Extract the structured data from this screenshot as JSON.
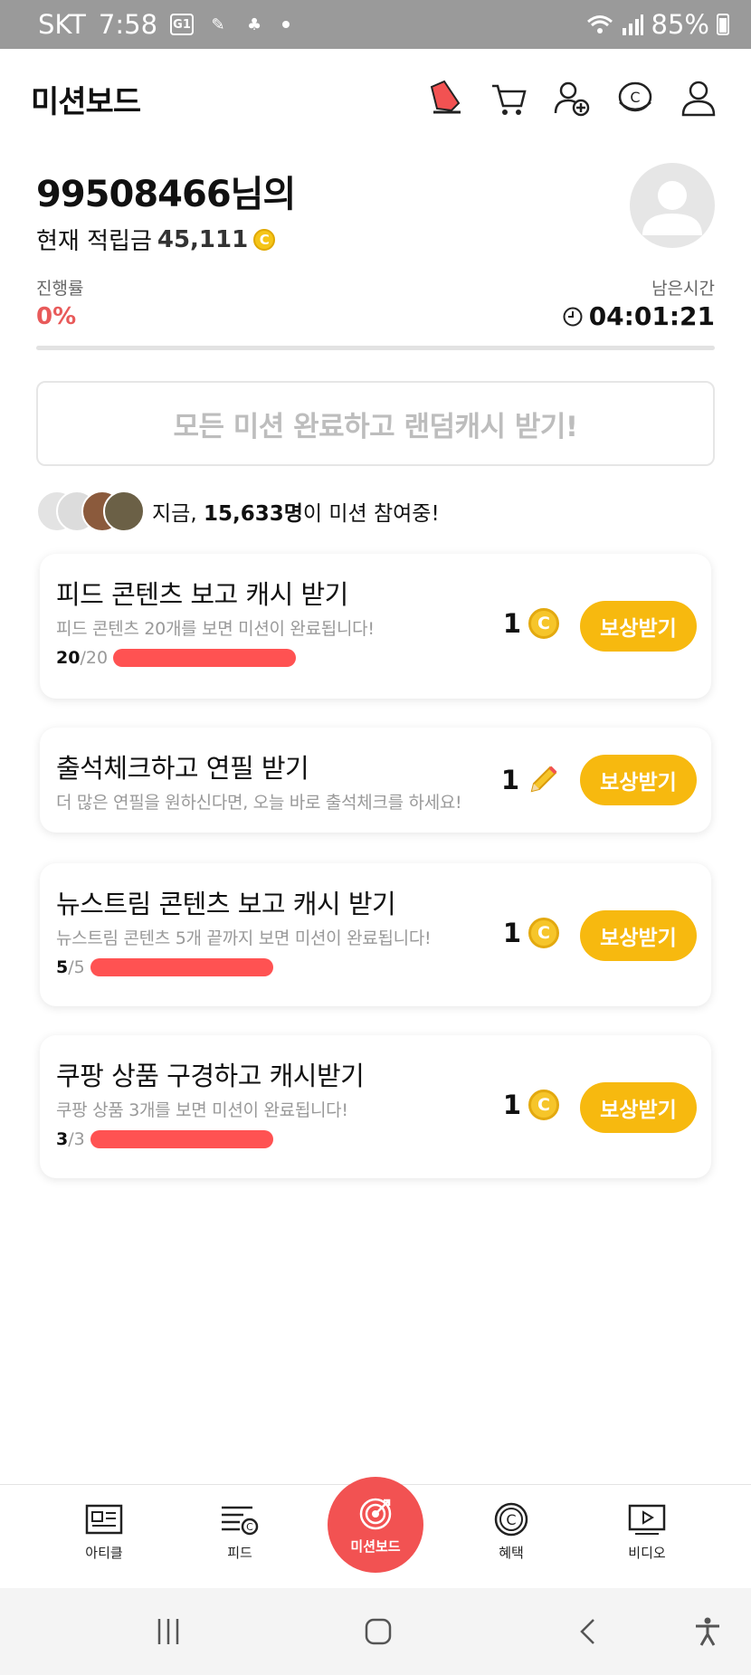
{
  "status_bar": {
    "carrier": "SKT",
    "time": "7:58",
    "battery": "85%"
  },
  "header": {
    "title": "미션보드"
  },
  "profile": {
    "name": "99508466님의",
    "balance_label": "현재 적립금",
    "balance": "45,111",
    "coin_symbol": "C"
  },
  "progress": {
    "label": "진행률",
    "value": "0%",
    "remaining_label": "남은시간",
    "remaining": "04:01:21"
  },
  "complete_all": {
    "label": "모든 미션 완료하고 랜덤캐시 받기!"
  },
  "participants": {
    "prefix": "지금, ",
    "count": "15,633명",
    "suffix": "이 미션 참여중!"
  },
  "missions": [
    {
      "title": "피드 콘텐츠 보고 캐시 받기",
      "desc": "피드 콘텐츠 20개를 보면 미션이 완료됩니다!",
      "current": "20",
      "total": "/20",
      "reward": "1",
      "reward_type": "coin-icon",
      "button": "보상받기",
      "progress": 1.0
    },
    {
      "title": "출석체크하고 연필 받기",
      "desc": "더 많은 연필을 원하신다면, 오늘 바로 출석체크를 하세요!",
      "reward": "1",
      "reward_type": "pencil-icon",
      "button": "보상받기"
    },
    {
      "title": "뉴스트림 콘텐츠 보고 캐시 받기",
      "desc": "뉴스트림 콘텐츠 5개 끝까지 보면 미션이 완료됩니다!",
      "current": "5",
      "total": "/5",
      "reward": "1",
      "reward_type": "coin-icon",
      "button": "보상받기",
      "progress": 1.0
    },
    {
      "title": "쿠팡 상품 구경하고 캐시받기",
      "desc": "쿠팡 상품 3개를 보면 미션이 완료됩니다!",
      "current": "3",
      "total": "/3",
      "reward": "1",
      "reward_type": "coin-icon",
      "button": "보상받기",
      "progress": 1.0
    }
  ],
  "bottom_nav": [
    {
      "label": "아티클",
      "icon": "article-icon"
    },
    {
      "label": "피드",
      "icon": "feed-icon"
    },
    {
      "label": "미션보드",
      "icon": "target-icon"
    },
    {
      "label": "혜택",
      "icon": "coin-outline-icon"
    },
    {
      "label": "비디오",
      "icon": "play-icon"
    }
  ],
  "colors": {
    "accent": "#f25252",
    "coin": "#f6c52a",
    "claim": "#f7b90f",
    "bar": "#ff5252"
  }
}
